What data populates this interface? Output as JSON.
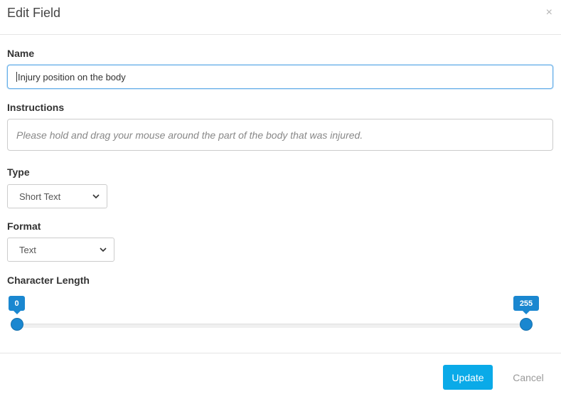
{
  "dialog": {
    "title": "Edit Field",
    "close_symbol": "×"
  },
  "name": {
    "label": "Name",
    "value": "Injury position on the body"
  },
  "instructions": {
    "label": "Instructions",
    "placeholder": "Please hold and drag your mouse around the part of the body that was injured."
  },
  "type": {
    "label": "Type",
    "selected": "Short Text"
  },
  "format": {
    "label": "Format",
    "selected": "Text"
  },
  "character_length": {
    "label": "Character Length",
    "min_value": "0",
    "max_value": "255"
  },
  "footer": {
    "update_label": "Update",
    "cancel_label": "Cancel"
  },
  "colors": {
    "primary": "#0aaae8",
    "slider": "#1a87d0"
  },
  "icons": [
    "close-icon",
    "chevron-down-icon"
  ]
}
